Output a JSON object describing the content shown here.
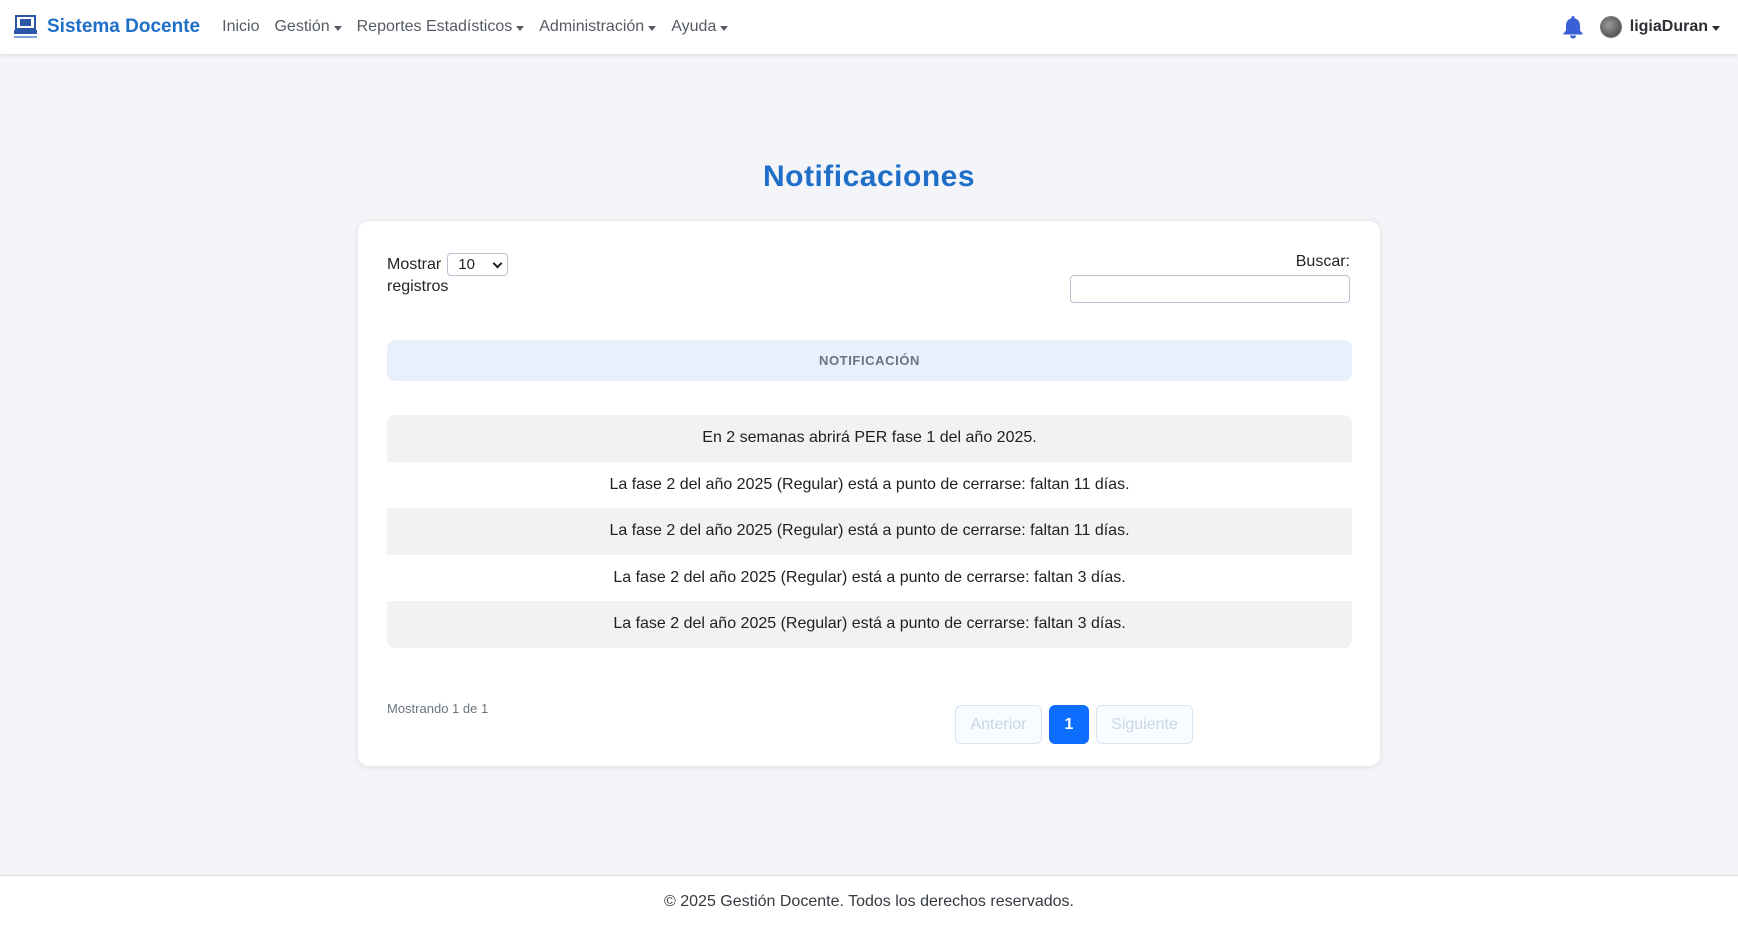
{
  "navbar": {
    "brand": "Sistema Docente",
    "links": [
      {
        "label": "Inicio",
        "dropdown": false
      },
      {
        "label": "Gestión",
        "dropdown": true
      },
      {
        "label": "Reportes Estadísticos",
        "dropdown": true
      },
      {
        "label": "Administración",
        "dropdown": true
      },
      {
        "label": "Ayuda",
        "dropdown": true
      }
    ],
    "user": "ligiaDuran",
    "icons": [
      "logo-icon",
      "bell-icon",
      "avatar",
      "caret-down-icon"
    ]
  },
  "page": {
    "title": "Notificaciones"
  },
  "table_controls": {
    "show_label": "Mostrar",
    "records_label": "registros",
    "page_length": "10",
    "search_label": "Buscar:",
    "search_value": ""
  },
  "table": {
    "header": "NOTIFICACIÓN",
    "rows": [
      "En 2 semanas abrirá PER fase 1 del año 2025.",
      "La fase 2 del año 2025 (Regular) está a punto de cerrarse: faltan 11 días.",
      "La fase 2 del año 2025 (Regular) está a punto de cerrarse: faltan 11 días.",
      "La fase 2 del año 2025 (Regular) está a punto de cerrarse: faltan 3 días.",
      "La fase 2 del año 2025 (Regular) está a punto de cerrarse: faltan 3 días."
    ]
  },
  "pagination": {
    "info": "Mostrando 1 de 1",
    "previous": "Anterior",
    "current": "1",
    "next": "Siguiente"
  },
  "footer": {
    "text": "© 2025 Gestión Docente. Todos los derechos reservados."
  },
  "colors": {
    "brand": "#1f6fc9",
    "accent": "#0d6efd",
    "background": "#f3f5f9",
    "bell": "#3b5fd6"
  }
}
